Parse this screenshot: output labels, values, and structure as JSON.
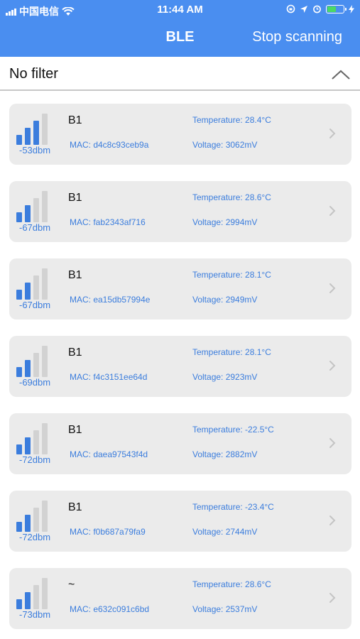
{
  "status_bar": {
    "carrier": "中国电信",
    "time": "11:44 AM",
    "icons": [
      "signal-icon",
      "wifi-icon",
      "rotation-lock-icon",
      "location-icon",
      "alarm-icon",
      "battery-charging-icon"
    ],
    "battery_level": 0.55
  },
  "nav": {
    "title": "BLE",
    "action_label": "Stop scanning",
    "bar_color": "#4a8ef0"
  },
  "filter": {
    "label": "No filter",
    "icon": "chevron-up-icon"
  },
  "colors": {
    "accent": "#3b7ddd",
    "signal_active": "#3b7ddd",
    "signal_inactive": "#d2d2d2",
    "card_bg": "#ebebeb"
  },
  "devices": [
    {
      "name": "B1",
      "rssi": "-53dbm",
      "mac": "MAC: d4c8c93ceb9a",
      "temperature": "Temperature: 28.4°C",
      "voltage": "Voltage: 3062mV",
      "signal_bars": 3
    },
    {
      "name": "B1",
      "rssi": "-67dbm",
      "mac": "MAC: fab2343af716",
      "temperature": "Temperature: 28.6°C",
      "voltage": "Voltage: 2994mV",
      "signal_bars": 2
    },
    {
      "name": "B1",
      "rssi": "-67dbm",
      "mac": "MAC: ea15db57994e",
      "temperature": "Temperature: 28.1°C",
      "voltage": "Voltage: 2949mV",
      "signal_bars": 2
    },
    {
      "name": "B1",
      "rssi": "-69dbm",
      "mac": "MAC: f4c3151ee64d",
      "temperature": "Temperature: 28.1°C",
      "voltage": "Voltage: 2923mV",
      "signal_bars": 2
    },
    {
      "name": "B1",
      "rssi": "-72dbm",
      "mac": "MAC: daea97543f4d",
      "temperature": "Temperature: -22.5°C",
      "voltage": "Voltage: 2882mV",
      "signal_bars": 2
    },
    {
      "name": "B1",
      "rssi": "-72dbm",
      "mac": "MAC: f0b687a79fa9",
      "temperature": "Temperature: -23.4°C",
      "voltage": "Voltage: 2744mV",
      "signal_bars": 2
    },
    {
      "name": "~",
      "rssi": "-73dbm",
      "mac": "MAC: e632c091c6bd",
      "temperature": "Temperature: 28.6°C",
      "voltage": "Voltage: 2537mV",
      "signal_bars": 2
    }
  ]
}
